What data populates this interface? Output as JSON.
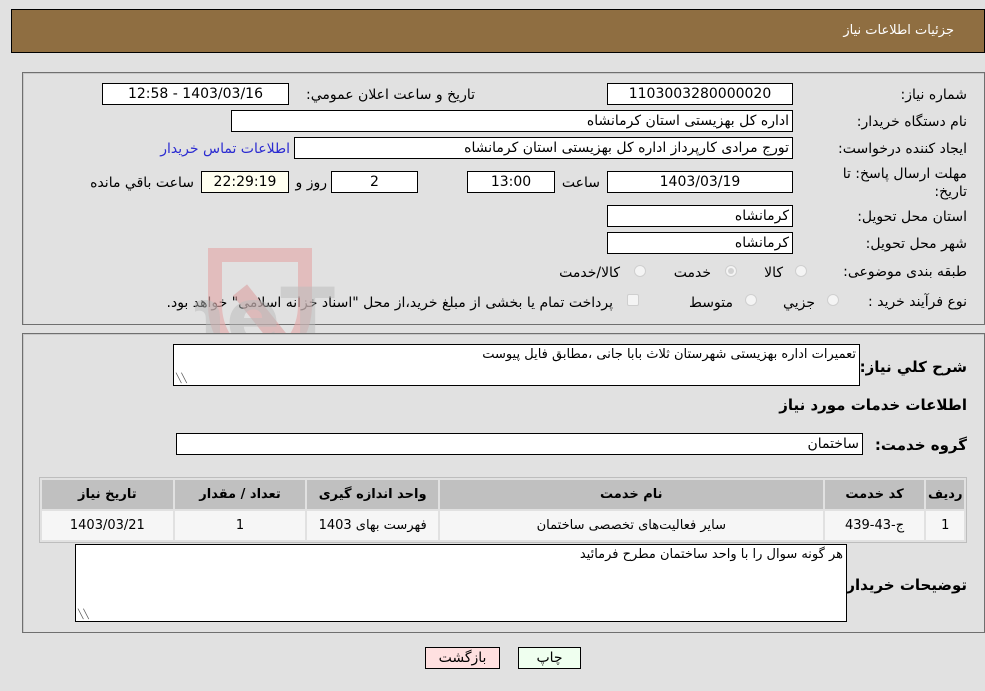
{
  "header": {
    "title": "جزئیات اطلاعات نیاز"
  },
  "form": {
    "need_number": {
      "label": "شماره نیاز:",
      "value": "1103003280000020"
    },
    "announce_datetime": {
      "label": "تاریخ و ساعت اعلان عمومي:",
      "value": "1403/03/16 - 12:58"
    },
    "buyer_org": {
      "label": "نام دستگاه خریدار:",
      "value": "اداره کل بهزیستی استان کرمانشاه"
    },
    "requester": {
      "label": "ایجاد کننده درخواست:",
      "value": "تورج مرادی کارپرداز  اداره کل بهزیستی استان کرمانشاه"
    },
    "buyer_contact_link": "اطلاعات تماس خریدار",
    "deadline": {
      "label_line1": "مهلت ارسال پاسخ: تا",
      "label_line2": "تاریخ:",
      "date": "1403/03/19",
      "time_label": "ساعت",
      "time": "13:00",
      "days": "2",
      "days_label": "روز و",
      "remaining": "22:29:19",
      "remaining_label": "ساعت باقي مانده"
    },
    "delivery_province": {
      "label": "استان محل تحویل:",
      "value": "کرمانشاه"
    },
    "delivery_city": {
      "label": "شهر محل تحویل:",
      "value": "کرمانشاه"
    },
    "category": {
      "label": "طبقه بندی موضوعی:",
      "options": [
        "کالا",
        "خدمت",
        "کالا/خدمت"
      ],
      "selected": "خدمت"
    },
    "purchase_type": {
      "label": "نوع فرآیند خرید :",
      "options": [
        "جزیي",
        "متوسط"
      ],
      "selected": null,
      "treasury_note": "پرداخت تمام یا بخشی از مبلغ خرید،از محل \"اسناد خزانه اسلامی\" خواهد بود.",
      "treasury_checked": false
    }
  },
  "details": {
    "description_label": "شرح کلي نیاز:",
    "description": "تعمیرات اداره بهزیستی شهرستان ثلاث بابا جانی ،مطابق فایل پیوست",
    "services_heading": "اطلاعات خدمات مورد نیاز",
    "service_group_label": "گروه خدمت:",
    "service_group": "ساختمان",
    "table": {
      "headers": [
        "ردیف",
        "کد خدمت",
        "نام خدمت",
        "واحد اندازه گیری",
        "تعداد / مقدار",
        "تاریخ نیاز"
      ],
      "rows": [
        [
          "1",
          "ج-43-439",
          "سایر فعالیت‌های تخصصی ساختمان",
          "فهرست بهای 1403",
          "1",
          "1403/03/21"
        ]
      ]
    },
    "buyer_notes_label": "توضیحات خریدار:",
    "buyer_notes": "هر گونه سوال را با واحد ساختمان مطرح فرمائید"
  },
  "buttons": {
    "print": "چاپ",
    "back": "بازگشت"
  },
  "colors": {
    "header_bg": "#8f6e41",
    "print_bg": "#efffef",
    "back_bg": "#ffe0e0",
    "link": "#2b2bd1"
  },
  "watermark": "AriaTender.neT"
}
